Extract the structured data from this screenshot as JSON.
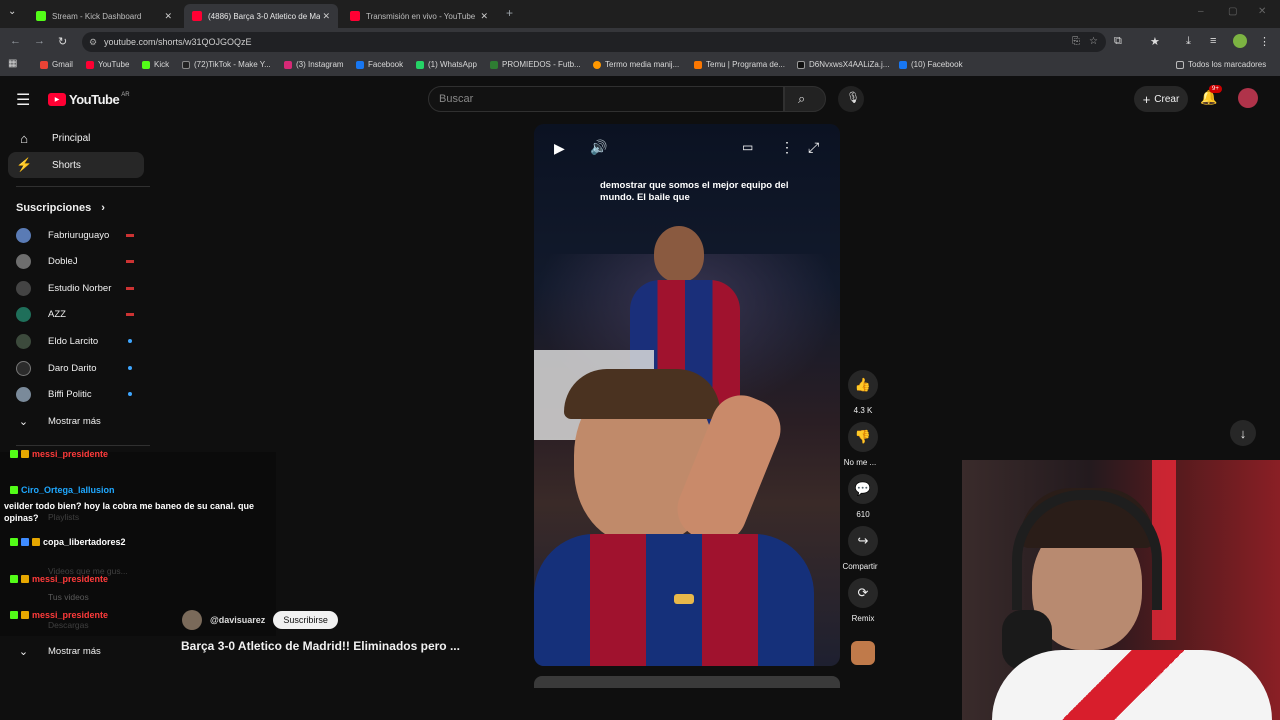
{
  "browser": {
    "tabs": [
      {
        "title": "Stream - Kick Dashboard",
        "color": "#53fc18"
      },
      {
        "title": "(4886) Barça 3-0 Atletico de Ma",
        "color": "#ff0033"
      },
      {
        "title": "Transmisión en vivo - YouTube",
        "color": "#ff0033"
      }
    ],
    "url": "youtube.com/shorts/w31QOJGOQzE",
    "bookmarks": [
      {
        "label": "Gmail",
        "color": "#ea4335"
      },
      {
        "label": "YouTube",
        "color": "#ff0033"
      },
      {
        "label": "Kick",
        "color": "#53fc18"
      },
      {
        "label": "(72)TikTok - Make Y...",
        "color": "#222222"
      },
      {
        "label": "(3) Instagram",
        "color": "#d62976"
      },
      {
        "label": "Facebook",
        "color": "#1877f2"
      },
      {
        "label": "(1) WhatsApp",
        "color": "#25d366"
      },
      {
        "label": "PROMIEDOS - Futb...",
        "color": "#2e7d32"
      },
      {
        "label": "Termo media manij...",
        "color": "#ff9800"
      },
      {
        "label": "Temu | Programa de...",
        "color": "#fb7701"
      },
      {
        "label": "D6NvxwsX4AALiZa.j...",
        "color": "#111111"
      },
      {
        "label": "(10) Facebook",
        "color": "#1877f2"
      }
    ],
    "all_bookmarks": "Todos los marcadores"
  },
  "youtube": {
    "logo_text": "YouTube",
    "region": "AR",
    "search_placeholder": "Buscar",
    "create_label": "Crear",
    "notif_count": "9+",
    "sidebar": {
      "main": [
        {
          "label": "Principal"
        },
        {
          "label": "Shorts"
        }
      ],
      "subs_title": "Suscripciones",
      "subscriptions": [
        {
          "name": "Fabriuruguayo",
          "indicator": "live",
          "avatar_color": "#5a7bb5"
        },
        {
          "name": "DobleJ",
          "indicator": "live",
          "avatar_color": "#6e6e6e"
        },
        {
          "name": "Estudio Norber",
          "indicator": "live",
          "avatar_color": "#444444"
        },
        {
          "name": "AZZ",
          "indicator": "live",
          "avatar_color": "#1f6f5a"
        },
        {
          "name": "Eldo Larcito",
          "indicator": "new",
          "avatar_color": "#3c4a3c"
        },
        {
          "name": "Daro Darito",
          "indicator": "new",
          "avatar_color": "#2b2b2b"
        },
        {
          "name": "Biffi Politic",
          "indicator": "new",
          "avatar_color": "#7a8a9a"
        }
      ],
      "show_more": "Mostrar más",
      "faded_items": [
        "Playlists",
        "Videos que me gus...",
        "Tus videos",
        "Descargas"
      ],
      "show_more_2": "Mostrar más"
    },
    "short": {
      "caption": "demostrar que somos el mejor equipo del mundo. El baile que",
      "channel": "@davisuarez",
      "subscribe": "Suscribirse",
      "title": "Barça 3-0 Atletico de Madrid!! Eliminados pero ...",
      "actions": [
        {
          "icon": "like-icon",
          "glyph": "👍",
          "label": "4.3 K"
        },
        {
          "icon": "dislike-icon",
          "glyph": "👎",
          "label": "No me ..."
        },
        {
          "icon": "comment-icon",
          "glyph": "💬",
          "label": "610"
        },
        {
          "icon": "share-icon",
          "glyph": "↪",
          "label": "Compartir"
        },
        {
          "icon": "remix-icon",
          "glyph": "⟳",
          "label": "Remix"
        }
      ]
    }
  },
  "chat": [
    {
      "user": "messi_presidente",
      "color": "#ff3b3b",
      "text": ""
    },
    {
      "user": "Ciro_Ortega_laIlusion",
      "color": "#1fa8ff",
      "text": "veilder todo bien? hoy la cobra me baneo de su canal. que opinas?"
    },
    {
      "user": "copa_libertadores2",
      "color": "#ffffff",
      "text": ""
    },
    {
      "user": "messi_presidente",
      "color": "#ff3b3b",
      "text": ""
    },
    {
      "user": "messi_presidente",
      "color": "#ff3b3b",
      "text": ""
    }
  ]
}
